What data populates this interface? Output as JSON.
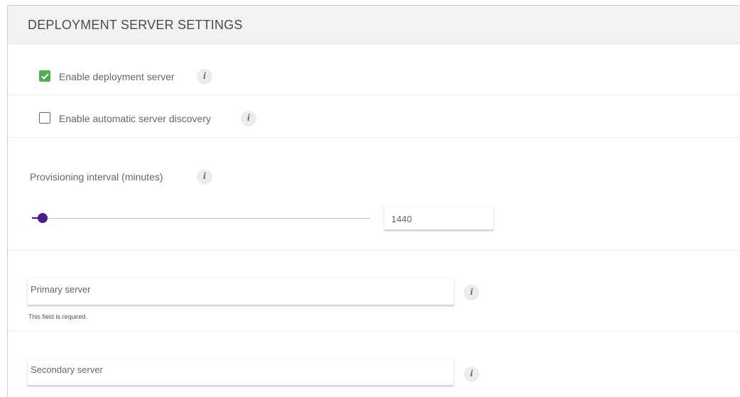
{
  "header": {
    "title": "DEPLOYMENT SERVER SETTINGS"
  },
  "enable_deployment": {
    "label": "Enable deployment server",
    "checked": true,
    "info_icon": "i"
  },
  "enable_discovery": {
    "label": "Enable automatic server discovery",
    "checked": false,
    "info_icon": "i"
  },
  "provisioning": {
    "label": "Provisioning interval (minutes)",
    "info_icon": "i",
    "value": "1440"
  },
  "primary_server": {
    "placeholder": "Primary server",
    "hint": "This field is required.",
    "info_icon": "i"
  },
  "secondary_server": {
    "placeholder": "Secondary server",
    "info_icon": "i"
  },
  "colors": {
    "accent": "#4caf50",
    "slider": "#4a1e8a"
  }
}
